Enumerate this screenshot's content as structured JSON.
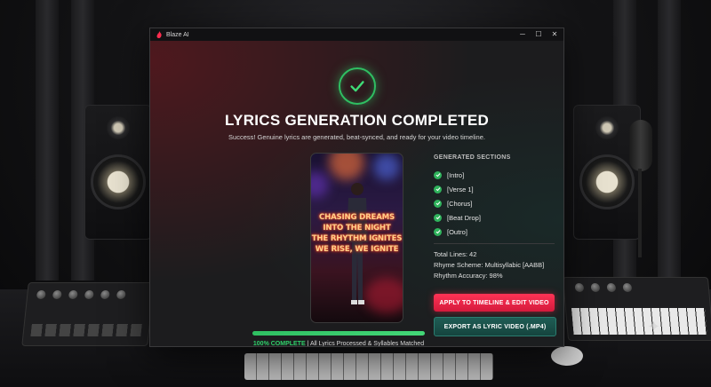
{
  "window": {
    "app_title": "Blaze AI",
    "minimize_glyph": "─",
    "maximize_glyph": "☐",
    "close_glyph": "✕",
    "accent": "#ff2d4f"
  },
  "hero": {
    "icon": "check-circle-icon",
    "title": "LYRICS GENERATION COMPLETED",
    "subtitle": "Success! Genuine lyrics are generated, beat-synced, and ready for your video timeline."
  },
  "preview": {
    "lyrics": [
      "CHASING DREAMS",
      "INTO THE NIGHT",
      "THE RHYTHM IGNITES",
      "WE RISE, WE IGNITE"
    ]
  },
  "sections": {
    "title": "GENERATED SECTIONS",
    "items": [
      {
        "label": "[Intro]",
        "icon": "check-icon"
      },
      {
        "label": "[Verse 1]",
        "icon": "check-icon"
      },
      {
        "label": "[Chorus]",
        "icon": "check-icon"
      },
      {
        "label": "[Beat Drop]",
        "icon": "check-icon"
      },
      {
        "label": "[Outro]",
        "icon": "check-icon"
      }
    ],
    "status_color": "#2fb35c"
  },
  "stats": {
    "total_lines": "Total Lines: 42",
    "rhyme_scheme": "Rhyme Scheme: Multisyllabic [AABB]",
    "rhythm_accuracy": "Rhythm Accuracy: 98%"
  },
  "actions": {
    "apply_label": "APPLY TO TIMELINE & EDIT VIDEO",
    "export_label": "EXPORT AS LYRIC VIDEO (.MP4)"
  },
  "progress": {
    "value": 1.0,
    "percent_label": "100% COMPLETE",
    "detail": " | All Lyrics Processed & Syllables Matched",
    "color": "#2fbf62"
  }
}
